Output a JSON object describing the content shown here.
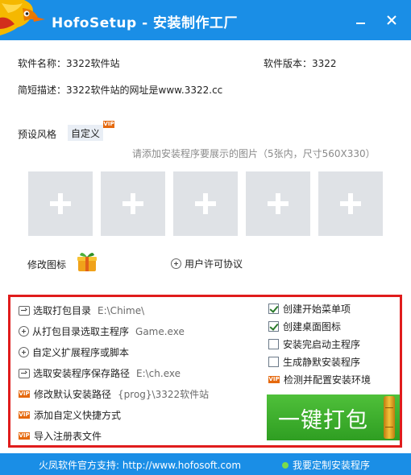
{
  "window": {
    "title": "HofoSetup - 安装制作工厂"
  },
  "info": {
    "name_label": "软件名称：",
    "name_value": "3322软件站",
    "version_label": "软件版本：",
    "version_value": "3322",
    "desc_label": "简短描述：",
    "desc_value": "3322软件站的网址是www.3322.cc"
  },
  "style": {
    "label": "预设风格",
    "tab_custom": "自定义",
    "vip": "VIP",
    "hint": "请添加安装程序要展示的图片（5张内，尺寸560X330）"
  },
  "slots": {
    "count": 5
  },
  "icon_row": {
    "modify_icon": "修改图标",
    "license": "用户许可协议"
  },
  "panel": {
    "rows": [
      {
        "label": "选取打包目录",
        "value": "E:\\Chime\\"
      },
      {
        "label": "从打包目录选取主程序",
        "value": "Game.exe"
      },
      {
        "label": "自定义扩展程序或脚本",
        "value": ""
      },
      {
        "label": "选取安装程序保存路径",
        "value": "E:\\ch.exe"
      },
      {
        "label": "修改默认安装路径",
        "value": "{prog}\\3322软件站"
      },
      {
        "label": "添加自定义快捷方式",
        "value": ""
      },
      {
        "label": "导入注册表文件",
        "value": ""
      }
    ],
    "options": [
      {
        "label": "创建开始菜单项",
        "checked": true
      },
      {
        "label": "创建桌面图标",
        "checked": true
      },
      {
        "label": "安装完启动主程序",
        "checked": false
      },
      {
        "label": "生成静默安装程序",
        "checked": false
      },
      {
        "label": "检测并配置安装环境",
        "checked": false
      }
    ],
    "build_button": "一键打包"
  },
  "footer": {
    "support": "火凤软件官方支持: http://www.hofosoft.com",
    "custom": "我要定制安装程序"
  }
}
